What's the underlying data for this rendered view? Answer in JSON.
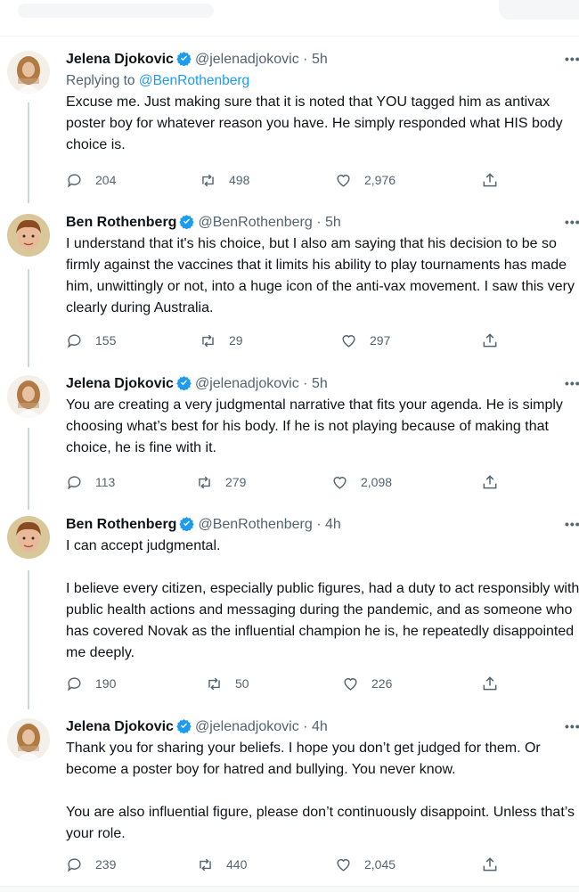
{
  "tweets": [
    {
      "name": "Jelena Djokovic",
      "handle": "@jelenadjokovic",
      "dot": "·",
      "time": "5h",
      "replying_prefix": "Replying to",
      "replying_handle": "@BenRothenberg",
      "text": "Excuse me. Just making sure that it is noted that YOU tagged him as antivax poster boy for whatever reason you have. He simply responded what HIS body choice is.",
      "replies": "204",
      "retweets": "498",
      "likes": "2,976"
    },
    {
      "name": "Ben Rothenberg",
      "handle": "@BenRothenberg",
      "dot": "·",
      "time": "5h",
      "text": "I understand that it's his choice, but I also am saying that his decision to be so firmly against the vaccines that it limits his ability to play tournaments has made him, unwittingly or not, into a huge icon of the anti-vax movement. I saw this very clearly during Australia.",
      "replies": "155",
      "retweets": "29",
      "likes": "297"
    },
    {
      "name": "Jelena Djokovic",
      "handle": "@jelenadjokovic",
      "dot": "·",
      "time": "5h",
      "text": "You are creating a very judgmental narrative that fits your agenda. He is simply choosing what’s best for his body. If he is not playing because of making that choice, he is fine with it.",
      "replies": "113",
      "retweets": "279",
      "likes": "2,098"
    },
    {
      "name": "Ben Rothenberg",
      "handle": "@BenRothenberg",
      "dot": "·",
      "time": "4h",
      "text": "I can accept judgmental.\n\nI believe every citizen, especially public figures, had a duty to act responsibly with public health actions and messaging during the pandemic, and as someone who has covered Novak as the influential champion he is, he repeatedly disappointed me deeply.",
      "replies": "190",
      "retweets": "50",
      "likes": "226"
    },
    {
      "name": "Jelena Djokovic",
      "handle": "@jelenadjokovic",
      "dot": "·",
      "time": "4h",
      "text": "Thank you for sharing your beliefs. I hope you don’t get judged for them. Or become a poster boy for hatred and bullying. You never know.\n\nYou are also influential figure, please don’t continuously disappoint. Unless that’s your role.",
      "replies": "239",
      "retweets": "440",
      "likes": "2,045"
    }
  ],
  "icons": {
    "verified": "verified-badge-icon",
    "reply": "reply-icon",
    "retweet": "retweet-icon",
    "like": "like-icon",
    "share": "share-icon",
    "more": "more-icon"
  },
  "colors": {
    "accent": "#1d9bf0",
    "secondary_text": "#536471",
    "thread_line": "#cfd9de"
  }
}
